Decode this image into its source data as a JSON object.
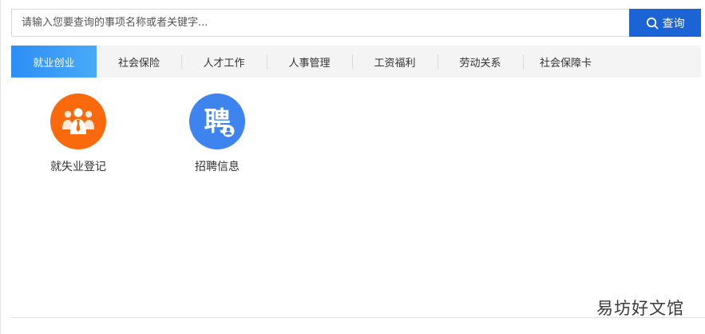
{
  "search": {
    "placeholder": "请输入您要查询的事项名称或者关键字...",
    "button_label": "查询",
    "button_icon": "search-icon",
    "button_color": "#1a64d6"
  },
  "tabs": [
    {
      "label": "就业创业",
      "active": true
    },
    {
      "label": "社会保险",
      "active": false
    },
    {
      "label": "人才工作",
      "active": false
    },
    {
      "label": "人事管理",
      "active": false
    },
    {
      "label": "工资福利",
      "active": false
    },
    {
      "label": "劳动关系",
      "active": false
    },
    {
      "label": "社会保障卡",
      "active": false
    }
  ],
  "services": [
    {
      "label": "就失业登记",
      "icon": "people-group-icon",
      "color": "#fa6a0c"
    },
    {
      "label": "招聘信息",
      "icon": "recruit-icon",
      "icon_text": "聘",
      "color": "#3d84ee"
    }
  ],
  "watermark": "易坊好文馆"
}
